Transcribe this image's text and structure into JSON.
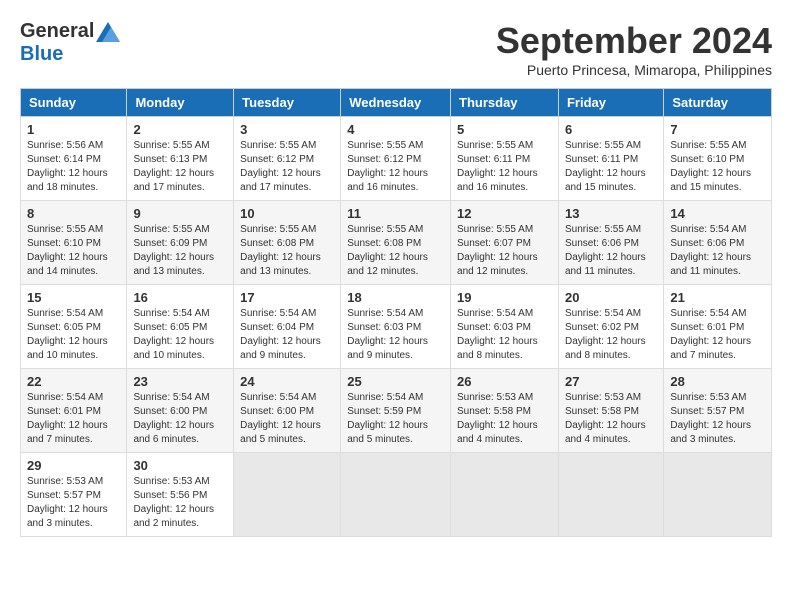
{
  "header": {
    "logo_general": "General",
    "logo_blue": "Blue",
    "month": "September 2024",
    "location": "Puerto Princesa, Mimaropa, Philippines"
  },
  "weekdays": [
    "Sunday",
    "Monday",
    "Tuesday",
    "Wednesday",
    "Thursday",
    "Friday",
    "Saturday"
  ],
  "weeks": [
    [
      {
        "day": "1",
        "sunrise": "Sunrise: 5:56 AM",
        "sunset": "Sunset: 6:14 PM",
        "daylight": "Daylight: 12 hours and 18 minutes."
      },
      {
        "day": "2",
        "sunrise": "Sunrise: 5:55 AM",
        "sunset": "Sunset: 6:13 PM",
        "daylight": "Daylight: 12 hours and 17 minutes."
      },
      {
        "day": "3",
        "sunrise": "Sunrise: 5:55 AM",
        "sunset": "Sunset: 6:12 PM",
        "daylight": "Daylight: 12 hours and 17 minutes."
      },
      {
        "day": "4",
        "sunrise": "Sunrise: 5:55 AM",
        "sunset": "Sunset: 6:12 PM",
        "daylight": "Daylight: 12 hours and 16 minutes."
      },
      {
        "day": "5",
        "sunrise": "Sunrise: 5:55 AM",
        "sunset": "Sunset: 6:11 PM",
        "daylight": "Daylight: 12 hours and 16 minutes."
      },
      {
        "day": "6",
        "sunrise": "Sunrise: 5:55 AM",
        "sunset": "Sunset: 6:11 PM",
        "daylight": "Daylight: 12 hours and 15 minutes."
      },
      {
        "day": "7",
        "sunrise": "Sunrise: 5:55 AM",
        "sunset": "Sunset: 6:10 PM",
        "daylight": "Daylight: 12 hours and 15 minutes."
      }
    ],
    [
      {
        "day": "8",
        "sunrise": "Sunrise: 5:55 AM",
        "sunset": "Sunset: 6:10 PM",
        "daylight": "Daylight: 12 hours and 14 minutes."
      },
      {
        "day": "9",
        "sunrise": "Sunrise: 5:55 AM",
        "sunset": "Sunset: 6:09 PM",
        "daylight": "Daylight: 12 hours and 13 minutes."
      },
      {
        "day": "10",
        "sunrise": "Sunrise: 5:55 AM",
        "sunset": "Sunset: 6:08 PM",
        "daylight": "Daylight: 12 hours and 13 minutes."
      },
      {
        "day": "11",
        "sunrise": "Sunrise: 5:55 AM",
        "sunset": "Sunset: 6:08 PM",
        "daylight": "Daylight: 12 hours and 12 minutes."
      },
      {
        "day": "12",
        "sunrise": "Sunrise: 5:55 AM",
        "sunset": "Sunset: 6:07 PM",
        "daylight": "Daylight: 12 hours and 12 minutes."
      },
      {
        "day": "13",
        "sunrise": "Sunrise: 5:55 AM",
        "sunset": "Sunset: 6:06 PM",
        "daylight": "Daylight: 12 hours and 11 minutes."
      },
      {
        "day": "14",
        "sunrise": "Sunrise: 5:54 AM",
        "sunset": "Sunset: 6:06 PM",
        "daylight": "Daylight: 12 hours and 11 minutes."
      }
    ],
    [
      {
        "day": "15",
        "sunrise": "Sunrise: 5:54 AM",
        "sunset": "Sunset: 6:05 PM",
        "daylight": "Daylight: 12 hours and 10 minutes."
      },
      {
        "day": "16",
        "sunrise": "Sunrise: 5:54 AM",
        "sunset": "Sunset: 6:05 PM",
        "daylight": "Daylight: 12 hours and 10 minutes."
      },
      {
        "day": "17",
        "sunrise": "Sunrise: 5:54 AM",
        "sunset": "Sunset: 6:04 PM",
        "daylight": "Daylight: 12 hours and 9 minutes."
      },
      {
        "day": "18",
        "sunrise": "Sunrise: 5:54 AM",
        "sunset": "Sunset: 6:03 PM",
        "daylight": "Daylight: 12 hours and 9 minutes."
      },
      {
        "day": "19",
        "sunrise": "Sunrise: 5:54 AM",
        "sunset": "Sunset: 6:03 PM",
        "daylight": "Daylight: 12 hours and 8 minutes."
      },
      {
        "day": "20",
        "sunrise": "Sunrise: 5:54 AM",
        "sunset": "Sunset: 6:02 PM",
        "daylight": "Daylight: 12 hours and 8 minutes."
      },
      {
        "day": "21",
        "sunrise": "Sunrise: 5:54 AM",
        "sunset": "Sunset: 6:01 PM",
        "daylight": "Daylight: 12 hours and 7 minutes."
      }
    ],
    [
      {
        "day": "22",
        "sunrise": "Sunrise: 5:54 AM",
        "sunset": "Sunset: 6:01 PM",
        "daylight": "Daylight: 12 hours and 7 minutes."
      },
      {
        "day": "23",
        "sunrise": "Sunrise: 5:54 AM",
        "sunset": "Sunset: 6:00 PM",
        "daylight": "Daylight: 12 hours and 6 minutes."
      },
      {
        "day": "24",
        "sunrise": "Sunrise: 5:54 AM",
        "sunset": "Sunset: 6:00 PM",
        "daylight": "Daylight: 12 hours and 5 minutes."
      },
      {
        "day": "25",
        "sunrise": "Sunrise: 5:54 AM",
        "sunset": "Sunset: 5:59 PM",
        "daylight": "Daylight: 12 hours and 5 minutes."
      },
      {
        "day": "26",
        "sunrise": "Sunrise: 5:53 AM",
        "sunset": "Sunset: 5:58 PM",
        "daylight": "Daylight: 12 hours and 4 minutes."
      },
      {
        "day": "27",
        "sunrise": "Sunrise: 5:53 AM",
        "sunset": "Sunset: 5:58 PM",
        "daylight": "Daylight: 12 hours and 4 minutes."
      },
      {
        "day": "28",
        "sunrise": "Sunrise: 5:53 AM",
        "sunset": "Sunset: 5:57 PM",
        "daylight": "Daylight: 12 hours and 3 minutes."
      }
    ],
    [
      {
        "day": "29",
        "sunrise": "Sunrise: 5:53 AM",
        "sunset": "Sunset: 5:57 PM",
        "daylight": "Daylight: 12 hours and 3 minutes."
      },
      {
        "day": "30",
        "sunrise": "Sunrise: 5:53 AM",
        "sunset": "Sunset: 5:56 PM",
        "daylight": "Daylight: 12 hours and 2 minutes."
      },
      null,
      null,
      null,
      null,
      null
    ]
  ]
}
